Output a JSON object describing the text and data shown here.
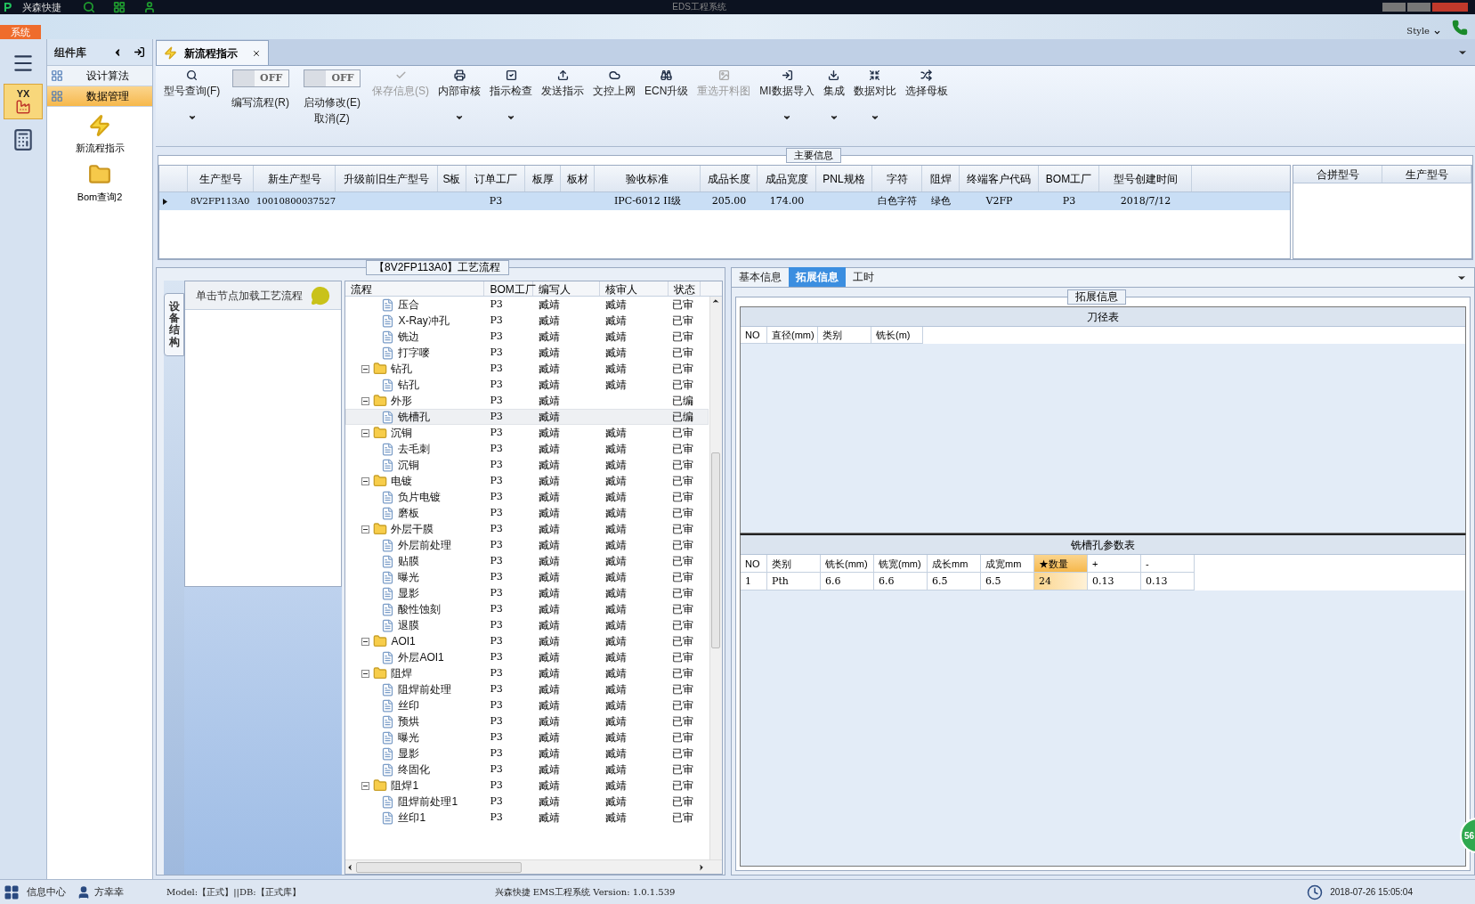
{
  "window": {
    "logo": "P",
    "app_name": "兴森快捷",
    "title": "EDS工程系统",
    "menu_tab": "系统",
    "style_label": "Style"
  },
  "sidebar": {
    "icons": [
      {
        "kind": "menu",
        "selected": false
      },
      {
        "kind": "factory",
        "label": "YX",
        "selected": true
      },
      {
        "kind": "calculator",
        "selected": false
      }
    ]
  },
  "component_panel": {
    "title": "组件库",
    "items": [
      {
        "label": "设计算法",
        "selected": false
      },
      {
        "label": "数据管理",
        "selected": true
      }
    ],
    "launchers": [
      {
        "kind": "bolt",
        "label": "新流程指示"
      },
      {
        "kind": "folder",
        "label": "Bom查询2"
      }
    ]
  },
  "doc_tabs": [
    {
      "label": "新流程指示",
      "selected": true
    }
  ],
  "toolbar": [
    {
      "kind": "button",
      "label": "型号查询(F)",
      "dropdown": true,
      "disabled": false
    },
    {
      "kind": "toggle",
      "label": "编写流程(R)",
      "state": "OFF",
      "on": false
    },
    {
      "kind": "toggle",
      "label": "启动修改(E)",
      "label2": "取消(Z)",
      "state": "OFF",
      "on": false
    },
    {
      "kind": "button",
      "label": "保存信息(S)",
      "dropdown": false,
      "disabled": true
    },
    {
      "kind": "button",
      "label": "内部审核",
      "dropdown": true,
      "disabled": false
    },
    {
      "kind": "button",
      "label": "指示检查",
      "dropdown": true,
      "disabled": false
    },
    {
      "kind": "button",
      "label": "发送指示",
      "dropdown": false,
      "disabled": false
    },
    {
      "kind": "button",
      "label": "文控上网",
      "dropdown": false,
      "disabled": false
    },
    {
      "kind": "button",
      "label": "ECN升级",
      "dropdown": false,
      "disabled": false
    },
    {
      "kind": "button",
      "label": "重选开料图",
      "dropdown": false,
      "disabled": true
    },
    {
      "kind": "button",
      "label": "MI数据导入",
      "dropdown": true,
      "disabled": false
    },
    {
      "kind": "button",
      "label": "集成",
      "dropdown": true,
      "disabled": false
    },
    {
      "kind": "button",
      "label": "数据对比",
      "dropdown": true,
      "disabled": false
    },
    {
      "kind": "button",
      "label": "选择母板",
      "dropdown": false,
      "disabled": false
    }
  ],
  "main_info": {
    "title": "主要信息",
    "columns": [
      "生产型号",
      "新生产型号",
      "升级前旧生产型号",
      "S板",
      "订单工厂",
      "板厚",
      "板材",
      "验收标准",
      "成品长度",
      "成品宽度",
      "PNL规格",
      "字符",
      "阻焊",
      "终端客户代码",
      "BOM工厂",
      "型号创建时间"
    ],
    "rows": [
      {
        "selected": true,
        "cells": [
          "8V2FP113A0",
          "10010800037527",
          null,
          null,
          "P3",
          null,
          null,
          "IPC-6012 II级",
          "205.00",
          "174.00",
          null,
          "白色字符",
          "绿色",
          "V2FP",
          "P3",
          "2018/7/12"
        ]
      }
    ],
    "side_columns": [
      "合拼型号",
      "生产型号"
    ]
  },
  "process": {
    "title": "【8V2FP113A0】工艺流程",
    "side_tab": "设备结构",
    "hint": "单击节点加载工艺流程",
    "columns": [
      "流程",
      "BOM工厂",
      "编写人",
      "核审人",
      "状态"
    ],
    "orphan_rows": [
      {
        "name": "压合",
        "bom": "P3",
        "author": "臧靖",
        "reviewer": "臧靖",
        "status": "已审",
        "selected": false
      },
      {
        "name": "X-Ray冲孔",
        "bom": "P3",
        "author": "臧靖",
        "reviewer": "臧靖",
        "status": "已审",
        "selected": false
      },
      {
        "name": "铣边",
        "bom": "P3",
        "author": "臧靖",
        "reviewer": "臧靖",
        "status": "已审",
        "selected": false
      },
      {
        "name": "打字嘜",
        "bom": "P3",
        "author": "臧靖",
        "reviewer": "臧靖",
        "status": "已审",
        "selected": false
      }
    ],
    "tree": [
      {
        "name": "钻孔",
        "bom": "P3",
        "author": "臧靖",
        "reviewer": "臧靖",
        "status": "已审",
        "expanded": true,
        "selected": false,
        "children": [
          {
            "name": "钻孔",
            "bom": "P3",
            "author": "臧靖",
            "reviewer": "臧靖",
            "status": "已审",
            "selected": false
          }
        ]
      },
      {
        "name": "外形",
        "bom": "P3",
        "author": "臧靖",
        "status": "已编",
        "expanded": true,
        "selected": false,
        "children": [
          {
            "name": "铣槽孔",
            "bom": "P3",
            "author": "臧靖",
            "status": "已编",
            "selected": true
          }
        ]
      },
      {
        "name": "沉铜",
        "bom": "P3",
        "author": "臧靖",
        "reviewer": "臧靖",
        "status": "已审",
        "expanded": true,
        "selected": false,
        "children": [
          {
            "name": "去毛刺",
            "bom": "P3",
            "author": "臧靖",
            "reviewer": "臧靖",
            "status": "已审",
            "selected": false
          },
          {
            "name": "沉铜",
            "bom": "P3",
            "author": "臧靖",
            "reviewer": "臧靖",
            "status": "已审",
            "selected": false
          }
        ]
      },
      {
        "name": "电镀",
        "bom": "P3",
        "author": "臧靖",
        "reviewer": "臧靖",
        "status": "已审",
        "expanded": true,
        "selected": false,
        "children": [
          {
            "name": "负片电镀",
            "bom": "P3",
            "author": "臧靖",
            "reviewer": "臧靖",
            "status": "已审",
            "selected": false
          },
          {
            "name": "磨板",
            "bom": "P3",
            "author": "臧靖",
            "reviewer": "臧靖",
            "status": "已审",
            "selected": false
          }
        ]
      },
      {
        "name": "外层干膜",
        "bom": "P3",
        "author": "臧靖",
        "reviewer": "臧靖",
        "status": "已审",
        "expanded": true,
        "selected": false,
        "children": [
          {
            "name": "外层前处理",
            "bom": "P3",
            "author": "臧靖",
            "reviewer": "臧靖",
            "status": "已审",
            "selected": false
          },
          {
            "name": "贴膜",
            "bom": "P3",
            "author": "臧靖",
            "reviewer": "臧靖",
            "status": "已审",
            "selected": false
          },
          {
            "name": "曝光",
            "bom": "P3",
            "author": "臧靖",
            "reviewer": "臧靖",
            "status": "已审",
            "selected": false
          },
          {
            "name": "显影",
            "bom": "P3",
            "author": "臧靖",
            "reviewer": "臧靖",
            "status": "已审",
            "selected": false
          },
          {
            "name": "酸性蚀刻",
            "bom": "P3",
            "author": "臧靖",
            "reviewer": "臧靖",
            "status": "已审",
            "selected": false
          },
          {
            "name": "退膜",
            "bom": "P3",
            "author": "臧靖",
            "reviewer": "臧靖",
            "status": "已审",
            "selected": false
          }
        ]
      },
      {
        "name": "AOI1",
        "bom": "P3",
        "author": "臧靖",
        "reviewer": "臧靖",
        "status": "已审",
        "expanded": true,
        "selected": false,
        "children": [
          {
            "name": "外层AOI1",
            "bom": "P3",
            "author": "臧靖",
            "reviewer": "臧靖",
            "status": "已审",
            "selected": false
          }
        ]
      },
      {
        "name": "阻焊",
        "bom": "P3",
        "author": "臧靖",
        "reviewer": "臧靖",
        "status": "已审",
        "expanded": true,
        "selected": false,
        "children": [
          {
            "name": "阻焊前处理",
            "bom": "P3",
            "author": "臧靖",
            "reviewer": "臧靖",
            "status": "已审",
            "selected": false
          },
          {
            "name": "丝印",
            "bom": "P3",
            "author": "臧靖",
            "reviewer": "臧靖",
            "status": "已审",
            "selected": false
          },
          {
            "name": "预烘",
            "bom": "P3",
            "author": "臧靖",
            "reviewer": "臧靖",
            "status": "已审",
            "selected": false
          },
          {
            "name": "曝光",
            "bom": "P3",
            "author": "臧靖",
            "reviewer": "臧靖",
            "status": "已审",
            "selected": false
          },
          {
            "name": "显影",
            "bom": "P3",
            "author": "臧靖",
            "reviewer": "臧靖",
            "status": "已审",
            "selected": false
          },
          {
            "name": "终固化",
            "bom": "P3",
            "author": "臧靖",
            "reviewer": "臧靖",
            "status": "已审",
            "selected": false
          }
        ]
      },
      {
        "name": "阻焊1",
        "bom": "P3",
        "author": "臧靖",
        "reviewer": "臧靖",
        "status": "已审",
        "expanded": true,
        "selected": false,
        "children": [
          {
            "name": "阻焊前处理1",
            "bom": "P3",
            "author": "臧靖",
            "reviewer": "臧靖",
            "status": "已审",
            "selected": false
          },
          {
            "name": "丝印1",
            "bom": "P3",
            "author": "臧靖",
            "reviewer": "臧靖",
            "status": "已审",
            "selected": false
          }
        ]
      }
    ]
  },
  "detail": {
    "tabs": [
      {
        "label": "基本信息",
        "selected": false
      },
      {
        "label": "拓展信息",
        "selected": true
      },
      {
        "label": "工时",
        "selected": false
      }
    ],
    "group_title": "拓展信息",
    "tool_table": {
      "title": "刀径表",
      "columns": [
        "NO",
        "直径(mm)",
        "类别",
        "铣长(m)"
      ]
    },
    "slot_table": {
      "title": "铣槽孔参数表",
      "columns": [
        {
          "label": "NO",
          "highlighted": false
        },
        {
          "label": "类别",
          "highlighted": false
        },
        {
          "label": "铣长(mm)",
          "highlighted": false
        },
        {
          "label": "铣宽(mm)",
          "highlighted": false
        },
        {
          "label": "成长mm",
          "highlighted": false
        },
        {
          "label": "成宽mm",
          "highlighted": false
        },
        {
          "label": "★数量",
          "highlighted": true
        },
        {
          "label": "+",
          "highlighted": false
        },
        {
          "label": "-",
          "highlighted": false
        }
      ],
      "rows": [
        [
          "1",
          "Pth",
          "6.6",
          "6.6",
          "6.5",
          "6.5",
          "24",
          "0.13",
          "0.13"
        ]
      ]
    }
  },
  "floating_badge": "56",
  "status_bar": {
    "info_center": "信息中心",
    "user": "方幸幸",
    "model": "Model:【正式】||DB:【正式库】",
    "version": "兴森快捷 EMS工程系统 Version: 1.0.1.539",
    "datetime": "2018-07-26 15:05:04"
  }
}
